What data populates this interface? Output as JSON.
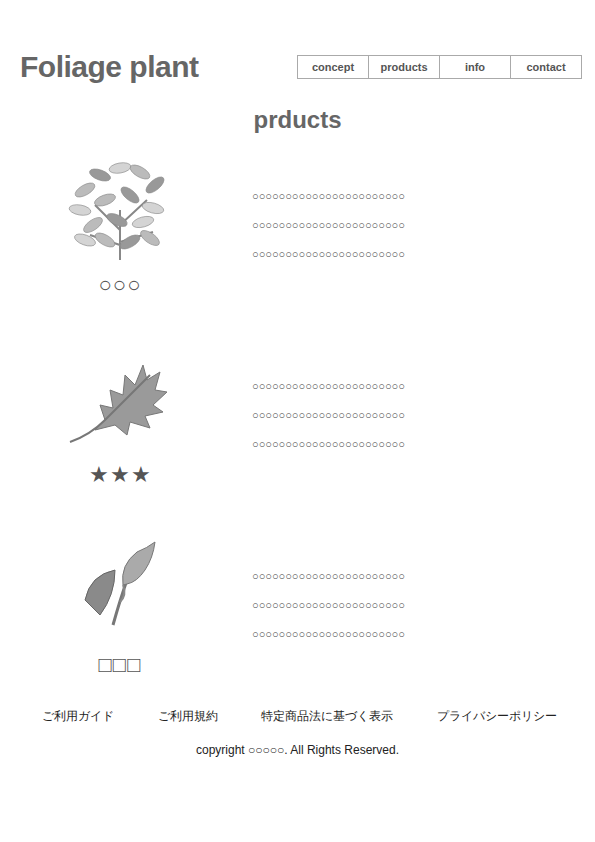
{
  "logo": "Foliage plant",
  "nav": [
    {
      "label": "concept"
    },
    {
      "label": "products"
    },
    {
      "label": "info"
    },
    {
      "label": "contact"
    }
  ],
  "title": "prducts",
  "products": [
    {
      "name": "○○○",
      "kind": "bush",
      "lines": [
        "○○○○○○○○○○○○○○○○○○○○○○○",
        "○○○○○○○○○○○○○○○○○○○○○○○",
        "○○○○○○○○○○○○○○○○○○○○○○○"
      ]
    },
    {
      "name": "★★★",
      "kind": "leaf",
      "lines": [
        "○○○○○○○○○○○○○○○○○○○○○○○",
        "○○○○○○○○○○○○○○○○○○○○○○○",
        "○○○○○○○○○○○○○○○○○○○○○○○"
      ]
    },
    {
      "name": "□□□",
      "kind": "bud",
      "lines": [
        "○○○○○○○○○○○○○○○○○○○○○○○",
        "○○○○○○○○○○○○○○○○○○○○○○○",
        "○○○○○○○○○○○○○○○○○○○○○○○"
      ]
    }
  ],
  "footer_links": [
    "ご利用ガイド",
    "ご利用規約",
    "特定商品法に基づく表示",
    "プライバシーポリシー"
  ],
  "copyright": "copyright ○○○○○. All Rights Reserved."
}
